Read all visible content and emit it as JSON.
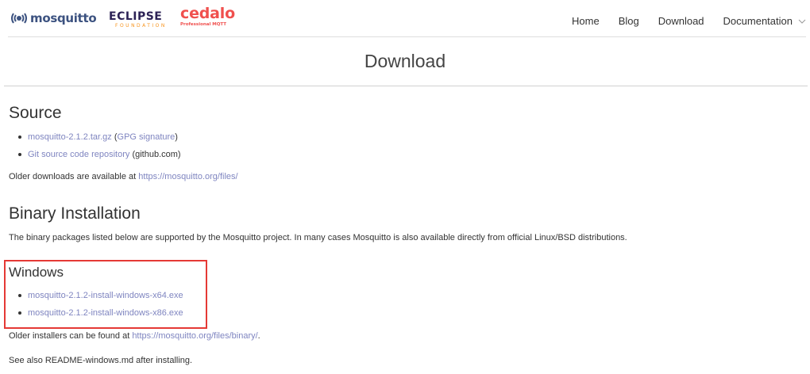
{
  "header": {
    "brand_mosquitto": "mosquitto",
    "brand_eclipse": "ECLIPSE",
    "brand_eclipse_sub": "FOUNDATION",
    "brand_cedalo": "cedalo",
    "brand_cedalo_sub": "Professional MQTT",
    "nav": {
      "home": "Home",
      "blog": "Blog",
      "download": "Download",
      "documentation": "Documentation"
    }
  },
  "page_title": "Download",
  "source": {
    "heading": "Source",
    "item1_link": "mosquitto-2.1.2.tar.gz",
    "item1_pre": " (",
    "item1_sig": "GPG signature",
    "item1_post": ")",
    "item2_link": "Git source code repository",
    "item2_post": " (github.com)",
    "older_text": "Older downloads are available at ",
    "older_link": "https://mosquitto.org/files/"
  },
  "binary": {
    "heading": "Binary Installation",
    "description": "The binary packages listed below are supported by the Mosquitto project. In many cases Mosquitto is also available directly from official Linux/BSD distributions."
  },
  "windows": {
    "heading": "Windows",
    "x64_link": "mosquitto-2.1.2-install-windows-x64.exe",
    "x86_link": "mosquitto-2.1.2-install-windows-x86.exe",
    "older_text": "Older installers can be found at ",
    "older_link": "https://mosquitto.org/files/binary/",
    "older_post": ".",
    "readme_text": "See also README-windows.md after installing."
  },
  "colors": {
    "link": "#7f85c0",
    "highlight_border": "#e53935",
    "mosquitto_brand": "#3c5280",
    "cedalo_brand": "#f0504e"
  }
}
